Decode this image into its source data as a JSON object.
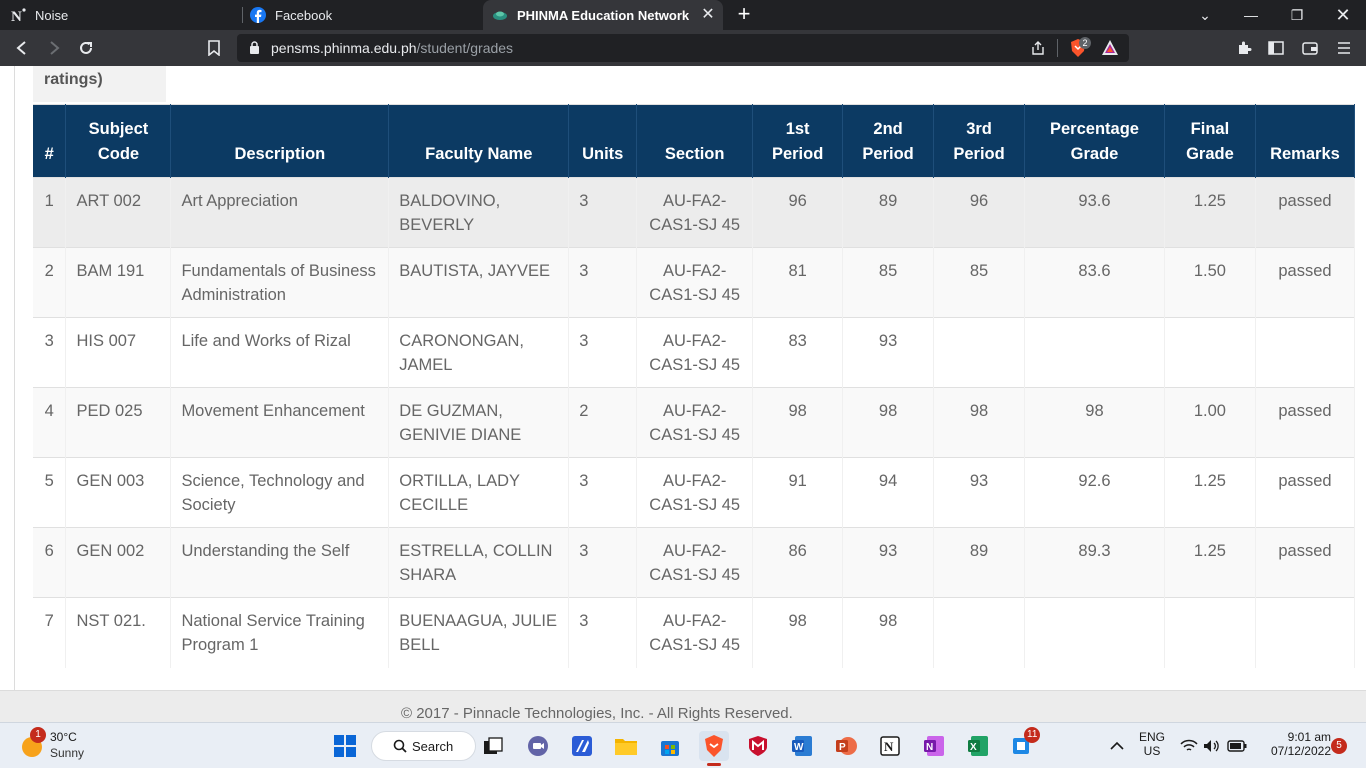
{
  "browser": {
    "tabs": [
      {
        "title": "Noise",
        "icon": "noise-n-icon"
      },
      {
        "title": "Facebook",
        "icon": "facebook-icon"
      },
      {
        "title": "PHINMA Education Network",
        "icon": "phinma-logo-icon",
        "active": true
      }
    ],
    "url_host": "pensms.phinma.edu.ph",
    "url_path": "/student/grades",
    "brave_badge": "2"
  },
  "page": {
    "legend_label": "ratings)",
    "columns": [
      "#",
      "Subject Code",
      "Description",
      "Faculty Name",
      "Units",
      "Section",
      "1st Period",
      "2nd Period",
      "3rd Period",
      "Percentage Grade",
      "Final Grade",
      "Remarks"
    ],
    "rows": [
      {
        "no": "1",
        "code": "ART 002",
        "description": "Art Appreciation",
        "faculty": "BALDOVINO, BEVERLY",
        "units": "3",
        "section": "AU-FA2-CAS1-SJ 45",
        "p1": "96",
        "p2": "89",
        "p3": "96",
        "percentage": "93.6",
        "final": "1.25",
        "remarks": "passed"
      },
      {
        "no": "2",
        "code": "BAM 191",
        "description": "Fundamentals of Business Administration",
        "faculty": "BAUTISTA, JAYVEE",
        "units": "3",
        "section": "AU-FA2-CAS1-SJ 45",
        "p1": "81",
        "p2": "85",
        "p3": "85",
        "percentage": "83.6",
        "final": "1.50",
        "remarks": "passed"
      },
      {
        "no": "3",
        "code": "HIS 007",
        "description": "Life and Works of Rizal",
        "faculty": "CARONONGAN, JAMEL",
        "units": "3",
        "section": "AU-FA2-CAS1-SJ 45",
        "p1": "83",
        "p2": "93",
        "p3": "",
        "percentage": "",
        "final": "",
        "remarks": ""
      },
      {
        "no": "4",
        "code": "PED 025",
        "description": "Movement Enhancement",
        "faculty": "DE GUZMAN, GENIVIE DIANE",
        "units": "2",
        "section": "AU-FA2-CAS1-SJ 45",
        "p1": "98",
        "p2": "98",
        "p3": "98",
        "percentage": "98",
        "final": "1.00",
        "remarks": "passed"
      },
      {
        "no": "5",
        "code": "GEN 003",
        "description": "Science, Technology and Society",
        "faculty": "ORTILLA, LADY CECILLE",
        "units": "3",
        "section": "AU-FA2-CAS1-SJ 45",
        "p1": "91",
        "p2": "94",
        "p3": "93",
        "percentage": "92.6",
        "final": "1.25",
        "remarks": "passed"
      },
      {
        "no": "6",
        "code": "GEN 002",
        "description": "Understanding the Self",
        "faculty": "ESTRELLA, COLLIN SHARA",
        "units": "3",
        "section": "AU-FA2-CAS1-SJ 45",
        "p1": "86",
        "p2": "93",
        "p3": "89",
        "percentage": "89.3",
        "final": "1.25",
        "remarks": "passed"
      },
      {
        "no": "7",
        "code": "NST 021.",
        "description": "National Service Training Program 1",
        "faculty": "BUENAAGUA, JULIE BELL",
        "units": "3",
        "section": "AU-FA2-CAS1-SJ 45",
        "p1": "98",
        "p2": "98",
        "p3": "",
        "percentage": "",
        "final": "",
        "remarks": ""
      }
    ],
    "footer": "© 2017 - Pinnacle Technologies, Inc. - All Rights Reserved."
  },
  "taskbar": {
    "weather_temp": "30°C",
    "weather_condition": "Sunny",
    "weather_badge": "1",
    "search_label": "Search",
    "teams_badge": "11",
    "language": "ENG",
    "region": "US",
    "time": "9:01 am",
    "date": "07/12/2022",
    "notification_count": "5"
  },
  "colors": {
    "header_bg": "#0c3a63",
    "header_text": "#ffffff",
    "row_shade": "#ececec",
    "row_text": "#666666"
  }
}
